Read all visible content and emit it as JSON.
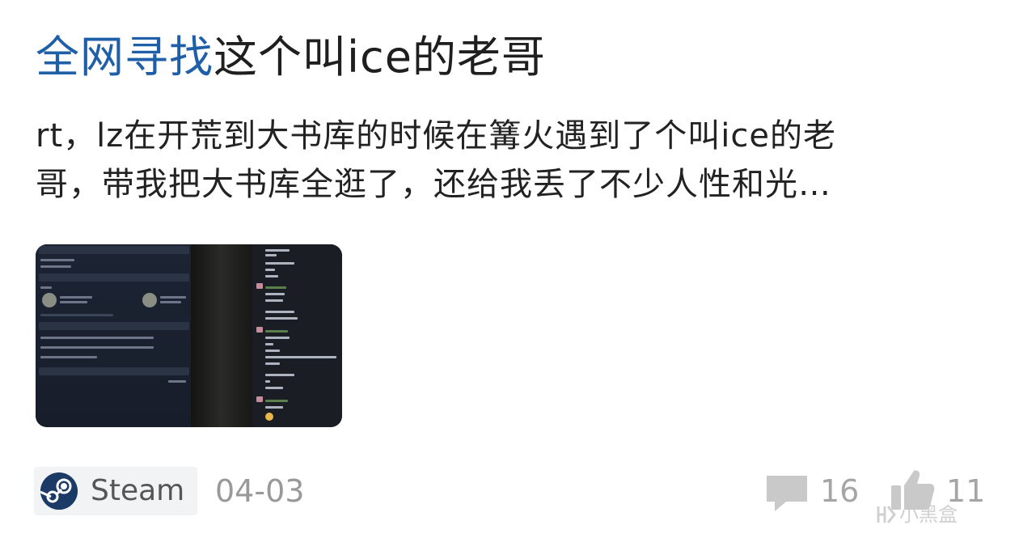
{
  "post": {
    "title_highlight": "全网寻找",
    "title_rest": "这个叫ice的老哥",
    "excerpt_line1": "rt，lz在开荒到大书库的时候在篝火遇到了个叫ice的老",
    "excerpt_line2": "哥，带我把大书库全逛了，还给我丢了不少人性和光…",
    "tag": "Steam",
    "date": "04-03",
    "comment_count": "16",
    "like_count": "11"
  },
  "icons": {
    "tag_logo": "steam-logo-icon",
    "comment": "comment-bubble-icon",
    "like": "thumbs-up-icon",
    "watermark": "xiaoheihe-logo-icon"
  },
  "watermark": "小黑盒",
  "colors": {
    "highlight": "#1e5fa8",
    "text": "#222222",
    "muted": "#999999"
  }
}
